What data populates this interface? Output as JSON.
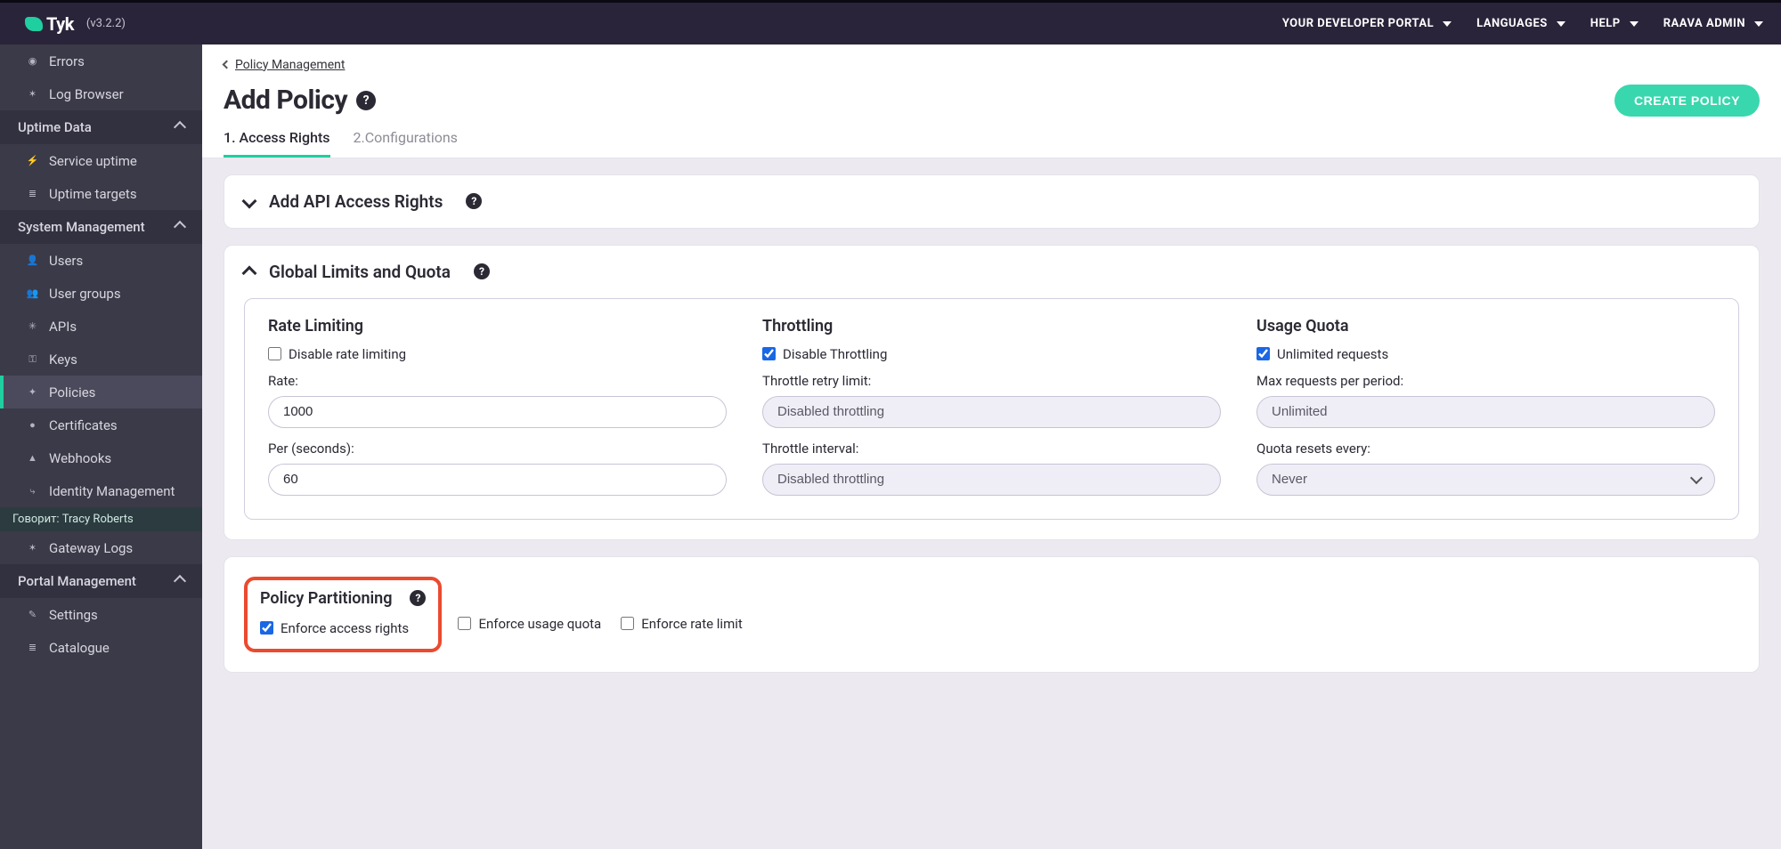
{
  "brand": {
    "name": "Tyk",
    "version": "(v3.2.2)"
  },
  "top_menu": [
    {
      "label": "YOUR DEVELOPER PORTAL"
    },
    {
      "label": "LANGUAGES"
    },
    {
      "label": "HELP"
    },
    {
      "label": "RAAVA ADMIN"
    }
  ],
  "sidebar": {
    "items_top": [
      {
        "icon": "bullet-icon",
        "label": "Errors"
      },
      {
        "icon": "bug-icon",
        "label": "Log Browser"
      }
    ],
    "section_uptime": {
      "label": "Uptime Data"
    },
    "items_uptime": [
      {
        "icon": "activity-icon",
        "label": "Service uptime"
      },
      {
        "icon": "target-icon",
        "label": "Uptime targets"
      }
    ],
    "section_system": {
      "label": "System Management"
    },
    "items_system": [
      {
        "icon": "user-icon",
        "label": "Users"
      },
      {
        "icon": "users-icon",
        "label": "User groups"
      },
      {
        "icon": "gear-icon",
        "label": "APIs"
      },
      {
        "icon": "key-icon",
        "label": "Keys"
      },
      {
        "icon": "policy-icon",
        "label": "Policies",
        "active": true
      },
      {
        "icon": "cert-icon",
        "label": "Certificates"
      },
      {
        "icon": "webhook-icon",
        "label": "Webhooks"
      },
      {
        "icon": "identity-icon",
        "label": "Identity Management"
      }
    ],
    "speaking_prefix": "Говорит:",
    "speaking_name": "Tracy Roberts",
    "items_bottom": [
      {
        "icon": "logs-icon",
        "label": "Gateway Logs"
      }
    ],
    "section_portal": {
      "label": "Portal Management"
    },
    "items_portal": [
      {
        "icon": "settings-icon",
        "label": "Settings"
      },
      {
        "icon": "catalogue-icon",
        "label": "Catalogue"
      }
    ]
  },
  "breadcrumb": {
    "label": "Policy Management"
  },
  "page": {
    "title": "Add Policy",
    "create_button": "CREATE POLICY"
  },
  "tabs": [
    {
      "label": "1. Access Rights",
      "active": true
    },
    {
      "label": "2.Configurations",
      "active": false
    }
  ],
  "panel_access": {
    "title": "Add API Access Rights"
  },
  "panel_limits": {
    "title": "Global Limits and Quota"
  },
  "limits": {
    "rate": {
      "title": "Rate Limiting",
      "disable_label": "Disable rate limiting",
      "disable_checked": false,
      "rate_label": "Rate:",
      "rate_value": "1000",
      "per_label": "Per (seconds):",
      "per_value": "60"
    },
    "throttle": {
      "title": "Throttling",
      "disable_label": "Disable Throttling",
      "disable_checked": true,
      "retry_label": "Throttle retry limit:",
      "retry_value": "Disabled throttling",
      "interval_label": "Throttle interval:",
      "interval_value": "Disabled throttling"
    },
    "quota": {
      "title": "Usage Quota",
      "unlimited_label": "Unlimited requests",
      "unlimited_checked": true,
      "max_label": "Max requests per period:",
      "max_value": "Unlimited",
      "reset_label": "Quota resets every:",
      "reset_value": "Never"
    }
  },
  "partition": {
    "title": "Policy Partitioning",
    "enforce_access": {
      "label": "Enforce access rights",
      "checked": true
    },
    "enforce_quota": {
      "label": "Enforce usage quota",
      "checked": false
    },
    "enforce_rate": {
      "label": "Enforce rate limit",
      "checked": false
    }
  }
}
